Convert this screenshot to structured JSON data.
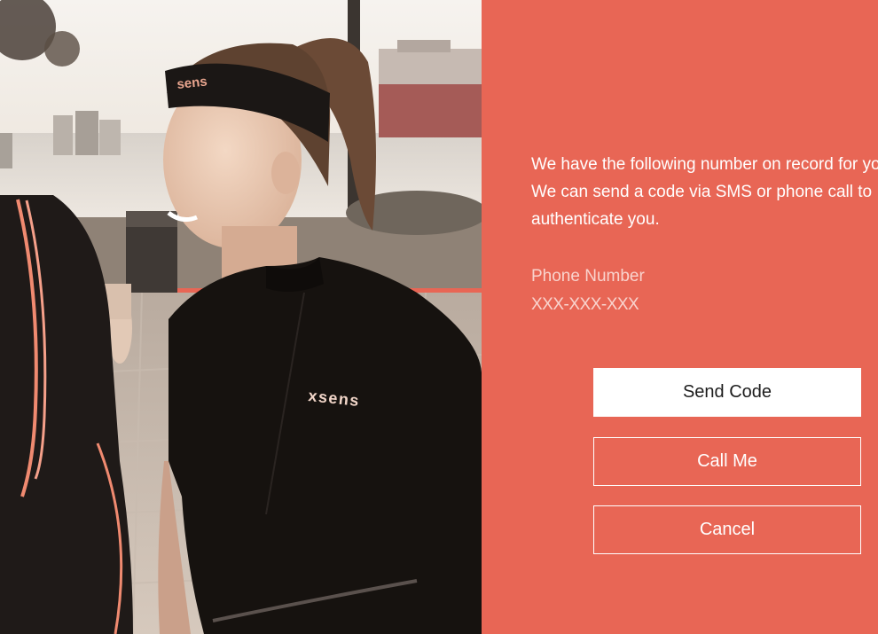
{
  "hero": {
    "shirt_logo_text": "xsens",
    "headband_logo_text": "sens"
  },
  "auth": {
    "message": "We have the following number on record for you. We can send a code via SMS or phone call to authenticate you.",
    "phone_label": "Phone Number",
    "phone_value": "XXX-XXX-XXX",
    "send_code_label": "Send Code",
    "call_me_label": "Call Me",
    "cancel_label": "Cancel"
  },
  "colors": {
    "panel_background": "#e86655",
    "primary_button_background": "#ffffff",
    "primary_button_text": "#1c1c1c",
    "outline_button_border": "#ffffff"
  }
}
